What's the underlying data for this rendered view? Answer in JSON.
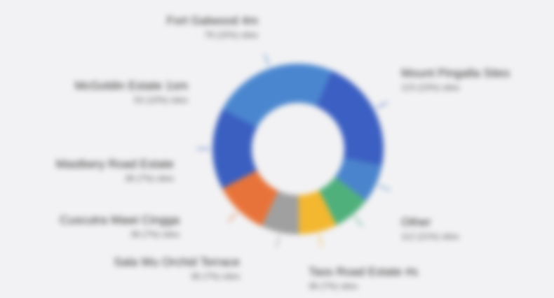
{
  "chart_data": {
    "type": "pie",
    "donut": true,
    "categories": [
      "Mount Pingalla Sites",
      "Other",
      "Tass Road Estate #s",
      "Sala Wu Orchid Terrace",
      "Cuscutra Mawi Cingga",
      "Mastbery Road Estate",
      "McGoldin Estate 1sm",
      "Fort Galwood 4m"
    ],
    "sublabels": [
      "123 (23%) sites",
      "112 (21%) sites",
      "38 (7%) sites",
      "36 (7%) sites",
      "36 (7%) sites",
      "38 (7%) sites",
      "53 (10%) sites",
      "79 (15%) sites"
    ],
    "values": [
      23,
      21,
      7,
      7,
      7,
      7,
      10,
      15
    ],
    "colors": [
      "#4a86cf",
      "#3b5fc2",
      "#4a84cc",
      "#4fb07c",
      "#f3b730",
      "#a0a0a0",
      "#e8733a",
      "#3a5fc0"
    ],
    "title": "",
    "legend": "none"
  }
}
